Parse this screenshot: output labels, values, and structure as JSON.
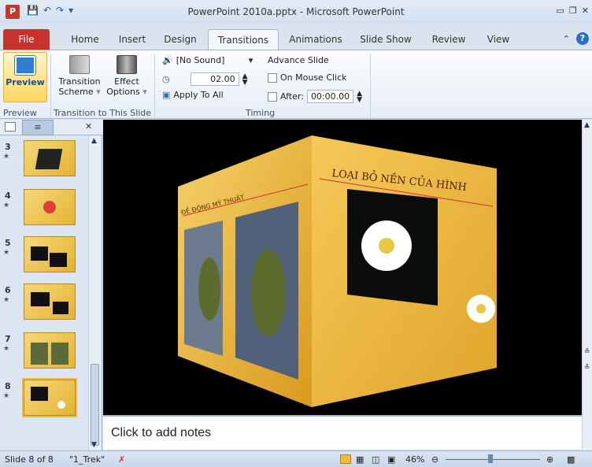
{
  "window": {
    "title": "PowerPoint 2010a.pptx - Microsoft PowerPoint",
    "app_icon": "P"
  },
  "tabs": [
    "File",
    "Home",
    "Insert",
    "Design",
    "Transitions",
    "Animations",
    "Slide Show",
    "Review",
    "View"
  ],
  "ribbon": {
    "preview_label": "Preview",
    "scheme_label1": "Transition",
    "scheme_label2": "Scheme",
    "effect_label1": "Effect",
    "effect_label2": "Options",
    "group1_label": "Preview",
    "group2_label": "Transition to This Slide",
    "group3_label": "Timing",
    "sound_value": "[No Sound]",
    "duration_value": "02.00",
    "apply_all_label": "Apply To All",
    "advance_label": "Advance Slide",
    "mouse_click_label": "On Mouse Click",
    "after_label": "After:",
    "after_value": "00:00.00"
  },
  "slides": [
    {
      "num": "3",
      "selected": false
    },
    {
      "num": "4",
      "selected": false
    },
    {
      "num": "5",
      "selected": false
    },
    {
      "num": "6",
      "selected": false
    },
    {
      "num": "7",
      "selected": false
    },
    {
      "num": "8",
      "selected": true
    }
  ],
  "slide_text": {
    "left_face": "ĐỀ ĐỘNG MỸ THUẬT",
    "right_face": "LOẠI BỎ NỀN CỦA HÌNH"
  },
  "notes_placeholder": "Click to add notes",
  "status": {
    "slide_info": "Slide 8 of 8",
    "theme": "\"1_Trek\"",
    "zoom": "46%"
  },
  "colors": {
    "file_tab": "#c4342c",
    "slide_gold": "#e9b43a",
    "stage_bg": "#000000"
  }
}
